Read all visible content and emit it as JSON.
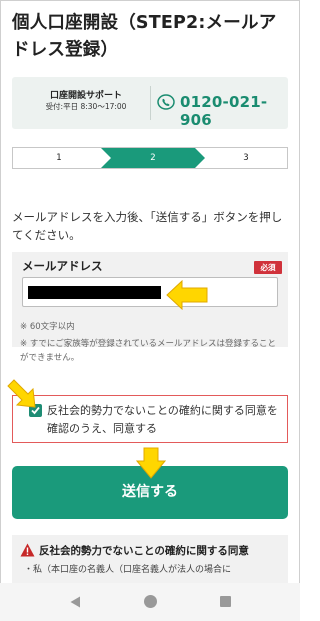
{
  "page": {
    "title": "個人口座開設（STEP2:メールアドレス登録）"
  },
  "support": {
    "name": "口座開設サポート",
    "hours": "受付:平日 8:30～17:00",
    "phone": "0120-021-906",
    "phone_icon": "phone-icon"
  },
  "steps": {
    "items": [
      "1",
      "2",
      "3"
    ],
    "current": 2,
    "active_color": "#1a9a7b"
  },
  "instruction": "メールアドレスを入力後、「送信する」ボタンを押してください。",
  "email": {
    "label": "メールアドレス",
    "required_badge": "必須",
    "value": "",
    "note_1": "※ 60文字以内",
    "note_2": "※ すでにご家族等が登録されているメールアドレスは登録することができません。"
  },
  "consent": {
    "checked": true,
    "text": "反社会的勢力でないことの確約に関する同意を確認のうえ、同意する"
  },
  "submit": {
    "label": "送信する",
    "color": "#1a9a7b"
  },
  "warning": {
    "icon": "warning-icon",
    "title": "反社会的勢力でないことの確約に関する同意",
    "body": "・私（本口座の名義人（口座名義人が法人の場合に"
  },
  "colors": {
    "brand": "#1a9a7b",
    "required": "#d0323b",
    "highlight_arrow": "#ffd600"
  }
}
